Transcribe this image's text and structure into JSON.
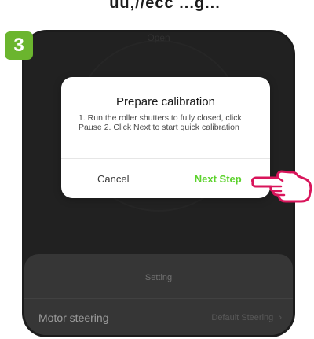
{
  "header": {
    "cropped_caption": "uu,//ecc ...g..."
  },
  "step_badge": {
    "label": "3",
    "color": "#6bb52e"
  },
  "background_screen": {
    "open_label": "Open",
    "settings": {
      "title": "Setting",
      "rows": [
        {
          "label": "Motor steering",
          "value": "Default Steering",
          "chevron": "chevron-right-icon"
        }
      ]
    }
  },
  "dialog": {
    "title": "Prepare calibration",
    "body": "1. Run the roller shutters to fully closed, click Pause 2. Click Next to start quick calibration",
    "cancel_label": "Cancel",
    "next_label": "Next Step",
    "next_color": "#5cd22c"
  },
  "pointer": {
    "icon": "pointing-hand-icon",
    "color": "#d9155b"
  }
}
